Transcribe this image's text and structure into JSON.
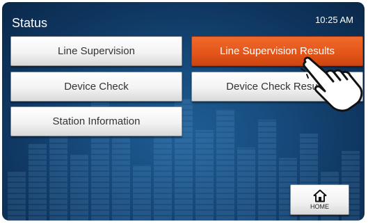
{
  "header": {
    "title": "Status",
    "time": "10:25 AM"
  },
  "buttons": {
    "line_supervision": "Line Supervision",
    "line_supervision_results": "Line Supervision Results",
    "device_check": "Device Check",
    "device_check_results": "Device Check Results",
    "station_information": "Station Information",
    "home": "HOME"
  },
  "icons": {
    "home": "home-icon",
    "pointer": "pointing-hand-icon"
  },
  "colors": {
    "accent_active": "#e35418",
    "background": "#174c7e"
  }
}
